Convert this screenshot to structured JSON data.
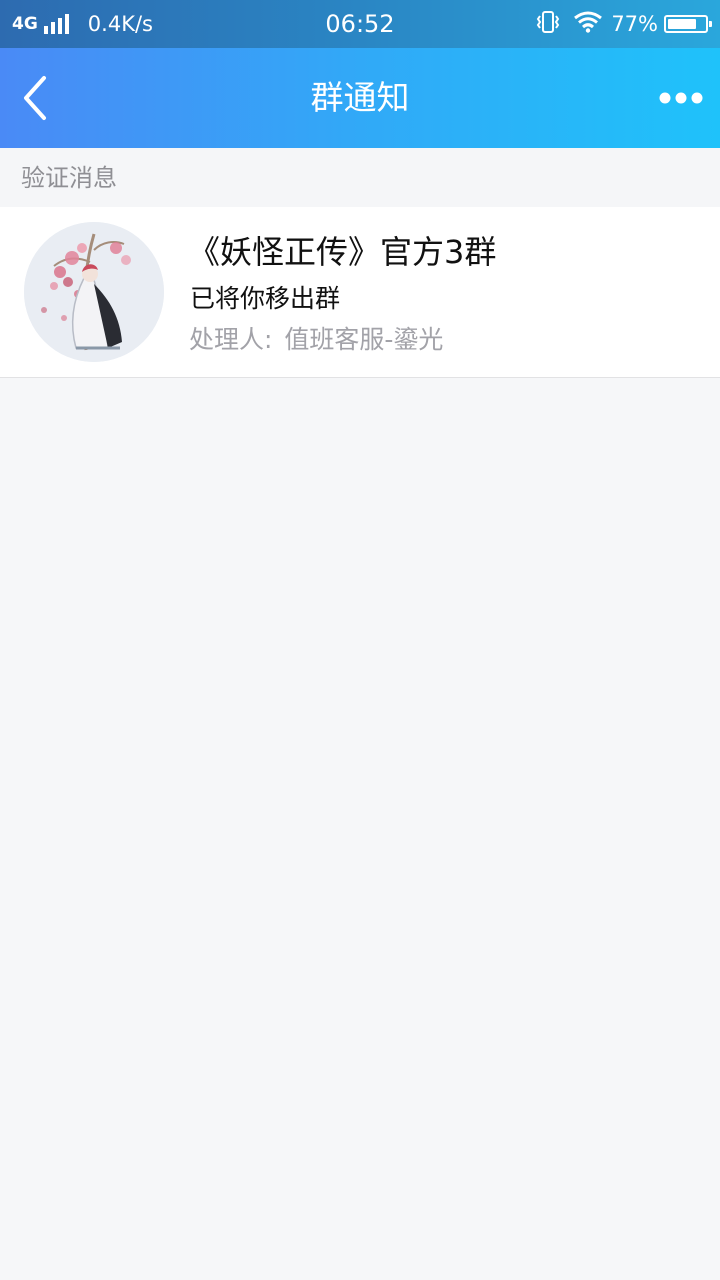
{
  "status_bar": {
    "network": "4G",
    "speed": "0.4K/s",
    "time": "06:52",
    "battery_percent": "77%",
    "battery_level": 0.77,
    "icons": [
      "signal-icon",
      "vibrate-icon",
      "wifi-icon",
      "battery-icon"
    ]
  },
  "nav": {
    "title": "群通知",
    "back_icon": "chevron-left-icon",
    "more_icon": "more-dots-icon"
  },
  "section": {
    "header": "验证消息"
  },
  "notifications": [
    {
      "group_name": "《妖怪正传》官方3群",
      "message": "已将你移出群",
      "handler_label": "处理人:",
      "handler_name": "值班客服-鎏光"
    }
  ],
  "colors": {
    "nav_gradient_start": "#4a8af6",
    "nav_gradient_end": "#1fc2fa",
    "page_background": "#f6f7f9",
    "secondary_text": "#a2a2a8"
  }
}
